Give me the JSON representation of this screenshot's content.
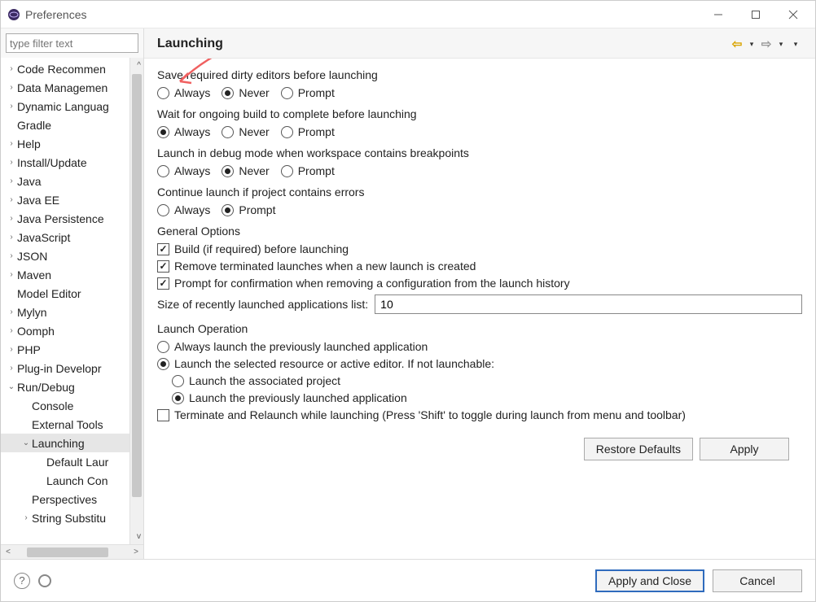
{
  "window": {
    "title": "Preferences"
  },
  "filter": {
    "placeholder": "type filter text"
  },
  "tree": {
    "items": [
      {
        "label": "Code Recommen",
        "indent": 0,
        "arrow": ">",
        "selected": false,
        "caret": "^"
      },
      {
        "label": "Data Managemen",
        "indent": 0,
        "arrow": ">"
      },
      {
        "label": "Dynamic Languag",
        "indent": 0,
        "arrow": ">"
      },
      {
        "label": "Gradle",
        "indent": 0,
        "arrow": ""
      },
      {
        "label": "Help",
        "indent": 0,
        "arrow": ">"
      },
      {
        "label": "Install/Update",
        "indent": 0,
        "arrow": ">"
      },
      {
        "label": "Java",
        "indent": 0,
        "arrow": ">"
      },
      {
        "label": "Java EE",
        "indent": 0,
        "arrow": ">"
      },
      {
        "label": "Java Persistence",
        "indent": 0,
        "arrow": ">"
      },
      {
        "label": "JavaScript",
        "indent": 0,
        "arrow": ">"
      },
      {
        "label": "JSON",
        "indent": 0,
        "arrow": ">"
      },
      {
        "label": "Maven",
        "indent": 0,
        "arrow": ">"
      },
      {
        "label": "Model Editor",
        "indent": 0,
        "arrow": ""
      },
      {
        "label": "Mylyn",
        "indent": 0,
        "arrow": ">"
      },
      {
        "label": "Oomph",
        "indent": 0,
        "arrow": ">"
      },
      {
        "label": "PHP",
        "indent": 0,
        "arrow": ">"
      },
      {
        "label": "Plug-in Developr",
        "indent": 0,
        "arrow": ">"
      },
      {
        "label": "Run/Debug",
        "indent": 0,
        "arrow": "v"
      },
      {
        "label": "Console",
        "indent": 1,
        "arrow": ""
      },
      {
        "label": "External Tools",
        "indent": 1,
        "arrow": ""
      },
      {
        "label": "Launching",
        "indent": 1,
        "arrow": "v",
        "selected": true
      },
      {
        "label": "Default Laur",
        "indent": 2,
        "arrow": ""
      },
      {
        "label": "Launch Con",
        "indent": 2,
        "arrow": ""
      },
      {
        "label": "Perspectives",
        "indent": 1,
        "arrow": ""
      },
      {
        "label": "String Substitu",
        "indent": 1,
        "arrow": ">",
        "caret": "v"
      }
    ]
  },
  "page": {
    "title": "Launching",
    "save_dirty": {
      "title": "Save required dirty editors before launching",
      "options": {
        "always": "Always",
        "never": "Never",
        "prompt": "Prompt"
      },
      "value": "never"
    },
    "wait_build": {
      "title": "Wait for ongoing build to complete before launching",
      "options": {
        "always": "Always",
        "never": "Never",
        "prompt": "Prompt"
      },
      "value": "always"
    },
    "debug_breakpoints": {
      "title": "Launch in debug mode when workspace contains breakpoints",
      "options": {
        "always": "Always",
        "never": "Never",
        "prompt": "Prompt"
      },
      "value": "never"
    },
    "continue_errors": {
      "title": "Continue launch if project contains errors",
      "options": {
        "always": "Always",
        "prompt": "Prompt"
      },
      "value": "prompt"
    },
    "general": {
      "title": "General Options",
      "build_before": {
        "label": "Build (if required) before launching",
        "checked": true
      },
      "remove_terminated": {
        "label": "Remove terminated launches when a new launch is created",
        "checked": true
      },
      "prompt_remove_history": {
        "label": "Prompt for confirmation when removing a configuration from the launch history",
        "checked": true
      },
      "history_size": {
        "label": "Size of recently launched applications list:",
        "value": "10"
      }
    },
    "launch_op": {
      "title": "Launch Operation",
      "always_previous": "Always launch the previously launched application",
      "selected_resource": "Launch the selected resource or active editor. If not launchable:",
      "assoc_project": "Launch the associated project",
      "previous_app": "Launch the previously launched application",
      "mode": "selected",
      "fallback": "previous",
      "terminate_relaunch": {
        "label": "Terminate and Relaunch while launching (Press 'Shift' to toggle during launch from menu and toolbar)",
        "checked": false
      }
    },
    "buttons": {
      "restore": "Restore Defaults",
      "apply": "Apply",
      "apply_close": "Apply and Close",
      "cancel": "Cancel"
    }
  }
}
